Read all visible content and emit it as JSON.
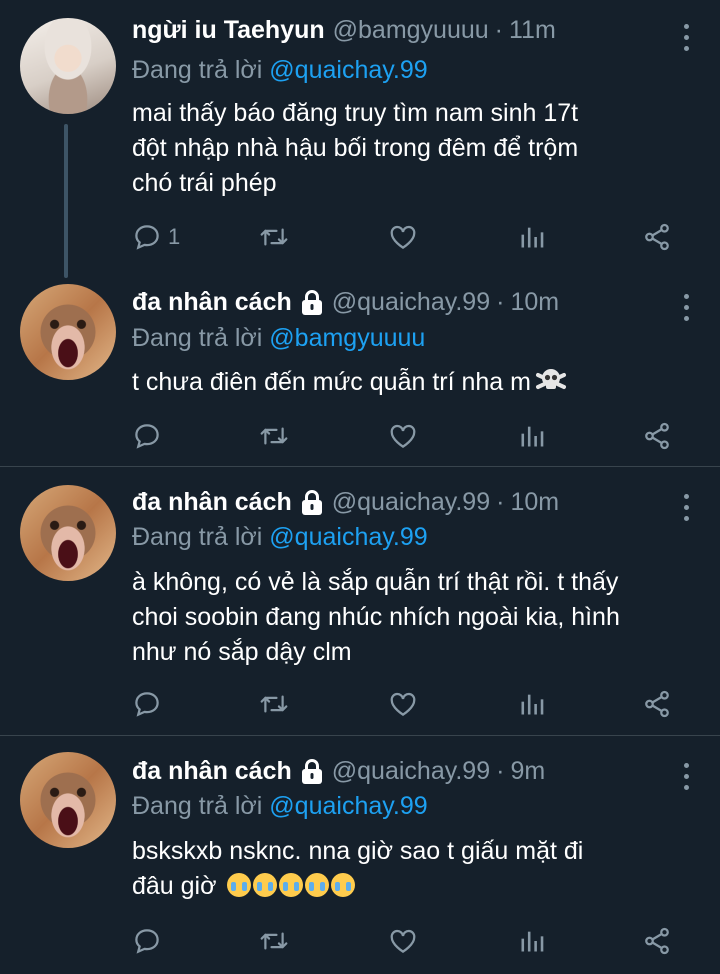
{
  "tweets": [
    {
      "name": "ngừi iu Taehyun",
      "locked": false,
      "handle": "@bamgyuuuu",
      "sep": "·",
      "time": "11m",
      "reply_prefix": "Đang trả lời",
      "reply_to": "@quaichay.99",
      "lines": [
        "mai thấy báo đăng truy tìm nam sinh 17t",
        "đột nhập nhà hậu bối trong đêm để trộm",
        "chó trái phép"
      ],
      "reply_count": "1",
      "avatar": "avatar-girl"
    },
    {
      "name": "đa nhân cách",
      "locked": true,
      "handle": "@quaichay.99",
      "sep": "·",
      "time": "10m",
      "reply_prefix": "Đang trả lời",
      "reply_to": "@bamgyuuuu",
      "lines": [
        "t chưa điên đến mức quẫn trí nha m"
      ],
      "emoji": "skull-crossbones",
      "reply_count": "",
      "avatar": "avatar-monkey"
    },
    {
      "name": "đa nhân cách",
      "locked": true,
      "handle": "@quaichay.99",
      "sep": "·",
      "time": "10m",
      "reply_prefix": "Đang trả lời",
      "reply_to": "@quaichay.99",
      "lines": [
        "à không, có vẻ là sắp quẫn trí thật rồi. t thấy",
        "choi soobin đang nhúc nhích ngoài kia, hình",
        "như nó sắp dậy clm"
      ],
      "reply_count": "",
      "avatar": "avatar-monkey"
    },
    {
      "name": "đa nhân cách",
      "locked": true,
      "handle": "@quaichay.99",
      "sep": "·",
      "time": "9m",
      "reply_prefix": "Đang trả lời",
      "reply_to": "@quaichay.99",
      "lines": [
        "bskskxb nsknc. nna giờ sao t giấu mặt đi",
        "đâu giờ"
      ],
      "emoji": "loudly-crying-face x5",
      "reply_count": "",
      "avatar": "avatar-monkey"
    }
  ],
  "colors": {
    "background": "#15202b",
    "muted": "#8899a6",
    "link": "#1da1f2",
    "divider": "#38444d"
  }
}
